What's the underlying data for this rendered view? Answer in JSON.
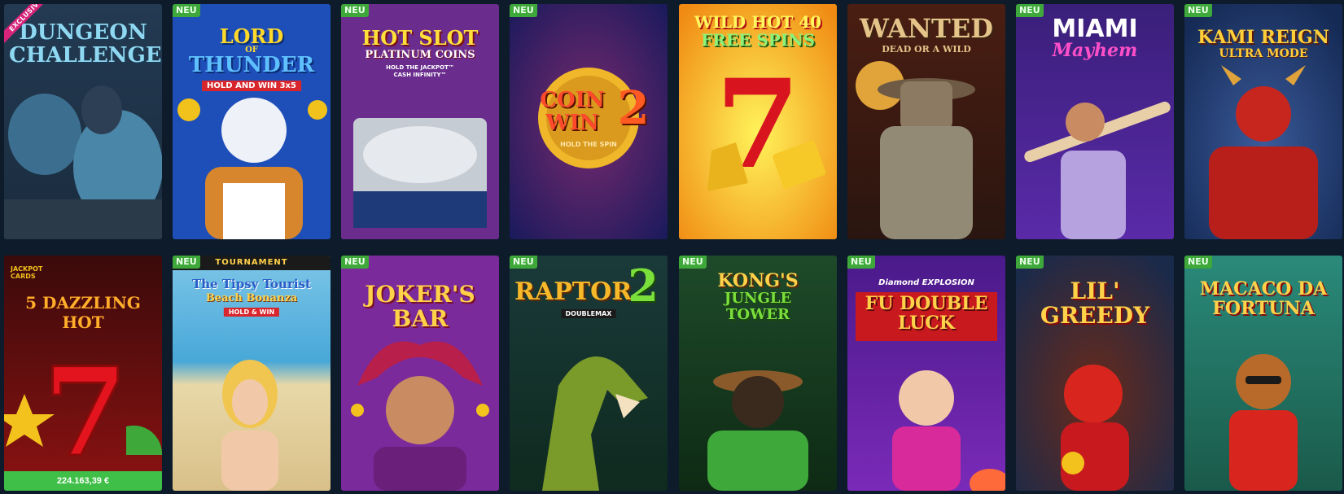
{
  "badges": {
    "neu": "NEU",
    "exclusive": "EXCLUSIVE"
  },
  "row1": [
    {
      "title_line1": "DUNGEON",
      "title_line2": "CHALLENGE",
      "badge": "exclusive"
    },
    {
      "title_line1": "LORD",
      "title_small": "OF",
      "title_line2": "THUNDER",
      "subtitle": "HOLD AND WIN 3x5",
      "badge": "neu"
    },
    {
      "title_line1": "HOT SLOT",
      "title_line2": "PLATINUM COINS",
      "subtitle": "HOLD THE JACKPOT™",
      "subtitle2": "CASH INFINITY™",
      "badge": "neu"
    },
    {
      "title_line1": "COIN",
      "title_line2": "WIN",
      "title_num": "2",
      "subtitle": "HOLD THE SPIN",
      "badge": "neu"
    },
    {
      "title_line1": "WILD HOT 40",
      "title_line2": "FREE SPINS",
      "badge": "none"
    },
    {
      "title_line1": "WANTED",
      "title_line2": "DEAD OR A WILD",
      "badge": "none"
    },
    {
      "title_line1": "MIAMI",
      "title_line2": "Mayhem",
      "badge": "neu"
    },
    {
      "title_line1": "KAMI REIGN",
      "title_line2": "ULTRA MODE",
      "badge": "neu"
    }
  ],
  "row2": [
    {
      "logo": "JACKPOT CARDS",
      "title_line1": "5 DAZZLING",
      "title_line2": "HOT",
      "jackpot": "224.163,39 €",
      "badge": "none"
    },
    {
      "top": "TOURNAMENT",
      "title_line1": "The Tipsy Tourist",
      "title_line2": "Beach Bonanza",
      "subtitle": "HOLD & WIN",
      "badge": "neu"
    },
    {
      "title_line1": "JOKER'S",
      "title_line2": "BAR",
      "badge": "neu"
    },
    {
      "title_line1": "RAPTOR",
      "title_num": "2",
      "subtitle": "DOUBLEMAX",
      "badge": "neu"
    },
    {
      "title_line1": "KONG'S",
      "title_line2": "JUNGLE",
      "title_line3": "TOWER",
      "badge": "neu"
    },
    {
      "top": "Diamond EXPLOSION",
      "title_line1": "FU DOUBLE",
      "title_line2": "LUCK",
      "badge": "neu"
    },
    {
      "title_line1": "LIL'",
      "title_line2": "GREEDY",
      "badge": "neu"
    },
    {
      "title_line1": "MACACO DA",
      "title_line2": "FORTUNA",
      "badge": "neu"
    }
  ],
  "colors": {
    "page_bg": "#0d1b2a",
    "neu_badge": "#3fa83a",
    "exclusive_badge": "#d6247a",
    "jackpot_bar": "#3fbf47"
  }
}
